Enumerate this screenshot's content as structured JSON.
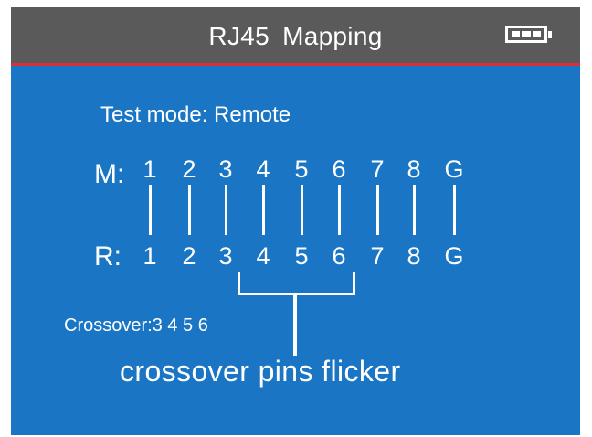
{
  "header": {
    "title": "RJ45  Mapping",
    "battery_icon": "battery-full-icon"
  },
  "test_mode": "Test mode: Remote",
  "main_row": {
    "label": "M:",
    "pins": [
      "1",
      "2",
      "3",
      "4",
      "5",
      "6",
      "7",
      "8",
      "G"
    ]
  },
  "remote_row": {
    "label": "R:",
    "pins": [
      "1",
      "2",
      "3",
      "4",
      "5",
      "6",
      "7",
      "8",
      "G"
    ]
  },
  "crossover_text": "Crossover:3 4 5 6",
  "annotation": "crossover pins flicker",
  "colors": {
    "screen_bg": "#1a76c4",
    "title_bg": "#5a5a5a",
    "title_border": "#d9313a",
    "foreground": "#ffffff"
  }
}
